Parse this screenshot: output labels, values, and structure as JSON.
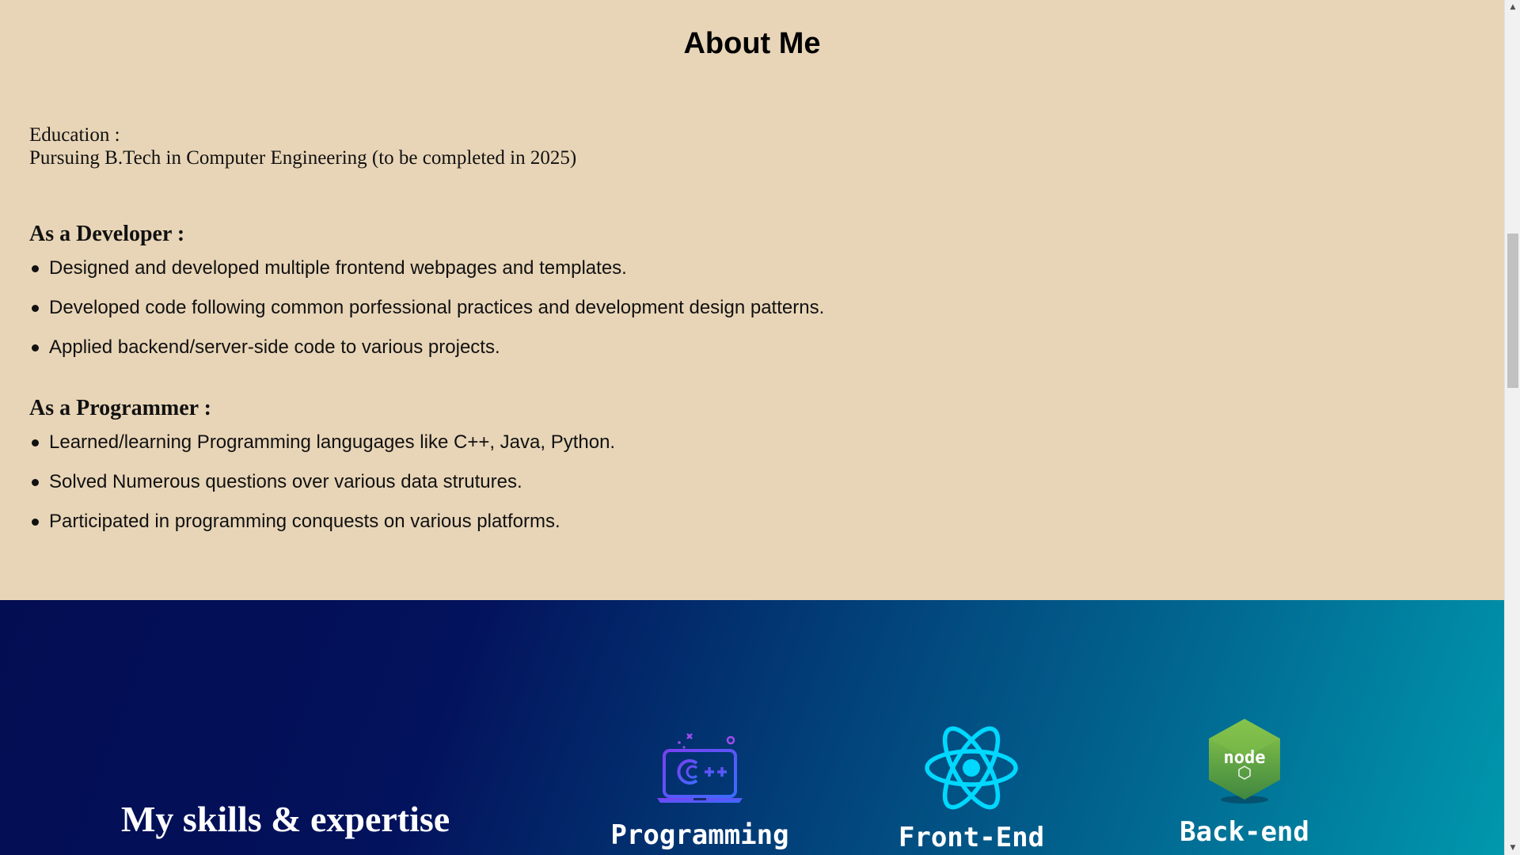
{
  "about": {
    "title": "About Me",
    "education_label": "Education :",
    "education_text": "Pursuing B.Tech in Computer Engineering (to be completed in 2025)",
    "developer_heading": "As a Developer :",
    "developer_items": [
      "Designed and developed multiple frontend webpages and templates.",
      "Developed code following common porfessional practices and development design patterns.",
      "Applied backend/server-side code to various projects."
    ],
    "programmer_heading": "As a Programmer :",
    "programmer_items": [
      "Learned/learning Programming langugages like C++, Java, Python.",
      "Solved Numerous questions over various data strutures.",
      "Participated in programming conquests on various platforms."
    ]
  },
  "skills": {
    "title": "My skills & expertise",
    "cards": [
      {
        "label": "Programming",
        "icon": "cpp-laptop-icon"
      },
      {
        "label": "Front-End",
        "icon": "react-icon"
      },
      {
        "label": "Back-end",
        "icon": "nodejs-icon",
        "logo_text": "node"
      }
    ]
  },
  "colors": {
    "about_bg": "#e8d5b7",
    "skills_gradient_start": "#030d52",
    "skills_gradient_end": "#0098ad",
    "react_cyan": "#00d8ff",
    "node_green": "#6cc24a"
  }
}
